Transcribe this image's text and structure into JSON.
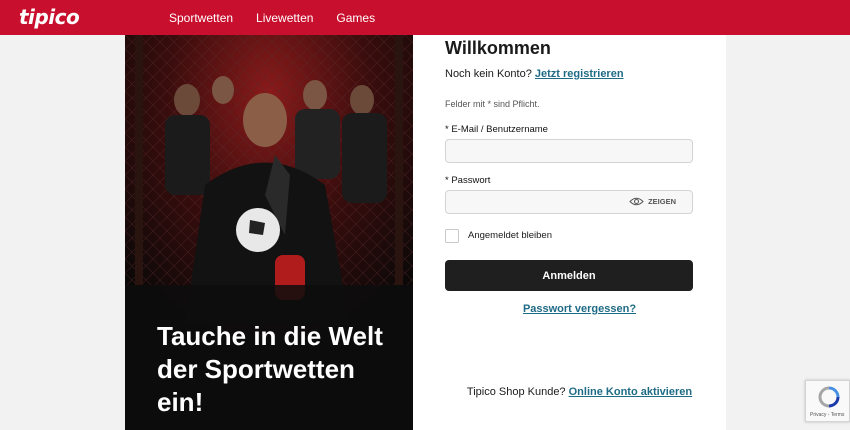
{
  "header": {
    "logo_text": "tipico",
    "nav": [
      {
        "label": "Sportwetten"
      },
      {
        "label": "Livewetten"
      },
      {
        "label": "Games"
      }
    ],
    "brand_color": "#c8102e"
  },
  "hero": {
    "headline": "Tauche in die Welt der Sportwetten ein!",
    "image_description_icon": "players-photo"
  },
  "login": {
    "title": "Willkommen",
    "no_account_text": "Noch kein Konto?",
    "register_link": "Jetzt registrieren",
    "required_note": "Felder mit * sind Pflicht.",
    "username_label": "* E-Mail / Benutzername",
    "username_value": "",
    "password_label": "* Passwort",
    "password_value": "",
    "show_password_label": "ZEIGEN",
    "remember_label": "Angemeldet bleiben",
    "remember_checked": false,
    "submit_label": "Anmelden",
    "forgot_link": "Passwort vergessen?",
    "shop_customer_text": "Tipico Shop Kunde?",
    "activate_link": "Online Konto aktivieren"
  },
  "recaptcha": {
    "text": "Privacy - Terms"
  }
}
